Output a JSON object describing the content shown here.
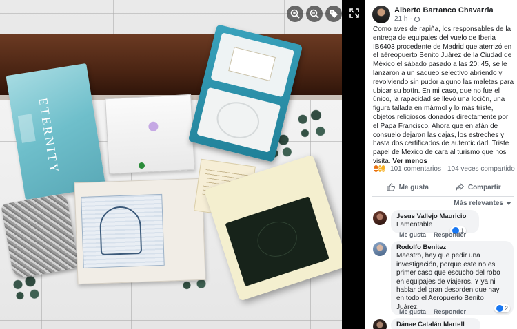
{
  "photo": {
    "package_brand": "ETERNITY",
    "buttons": [
      "zoom-in",
      "zoom-out",
      "tag"
    ]
  },
  "post": {
    "author": "Alberto Barranco Chavarria",
    "time": "21 h",
    "text": "Como aves de rapiña, los responsables de la entrega de equipajes del vuelo de Iberia IB6403 procedente de Madrid que aterrizó en el aéreopuerto Benito Juárez de la Ciudad de México el sábado pasado a las 20: 45, se le lanzaron a un saqueo selectivo abriendo y revolviendo sin pudor alguno las maletas para ubicar su botín. En mi caso, que no fue el único, la rapacidad se llevó una loción, una figura tallada en mármol y lo más triste, objetos religiosos donados directamente por el Papa Francisco. Ahora que en afán de consuelo dejaron las cajas, los estreches y hasta dos certificados de autenticidad. Triste papel de Mexico de cara al turismo que nos visita.",
    "see_more": "Ver menos",
    "comments_count": "101 comentarios",
    "shares_count": "104 veces compartido",
    "like_label": "Me gusta",
    "share_label": "Compartir",
    "sort_label": "Más relevantes"
  },
  "comments": [
    {
      "name": "Jesus Vallejo Mauricio",
      "text": "Lamentable",
      "action_like": "Me gusta",
      "action_reply": "Responder",
      "likes": "1"
    },
    {
      "name": "Rodolfo Benitez",
      "text": "Maestro, hay que pedir una investigación, porque este no es primer caso que escucho del robo en equipajes de viajeros. Y ya ni hablar del gran desorden que hay en todo el Aeropuerto Benito Juárez.",
      "action_like": "Me gusta",
      "action_reply": "Responder",
      "likes": "2"
    },
    {
      "name": "Dánae Catalán Martell",
      "text": ""
    }
  ],
  "colors": {
    "facebook_blue": "#1877f2",
    "text_primary": "#1c1e21",
    "text_secondary": "#606770",
    "bubble": "#f2f3f5"
  }
}
